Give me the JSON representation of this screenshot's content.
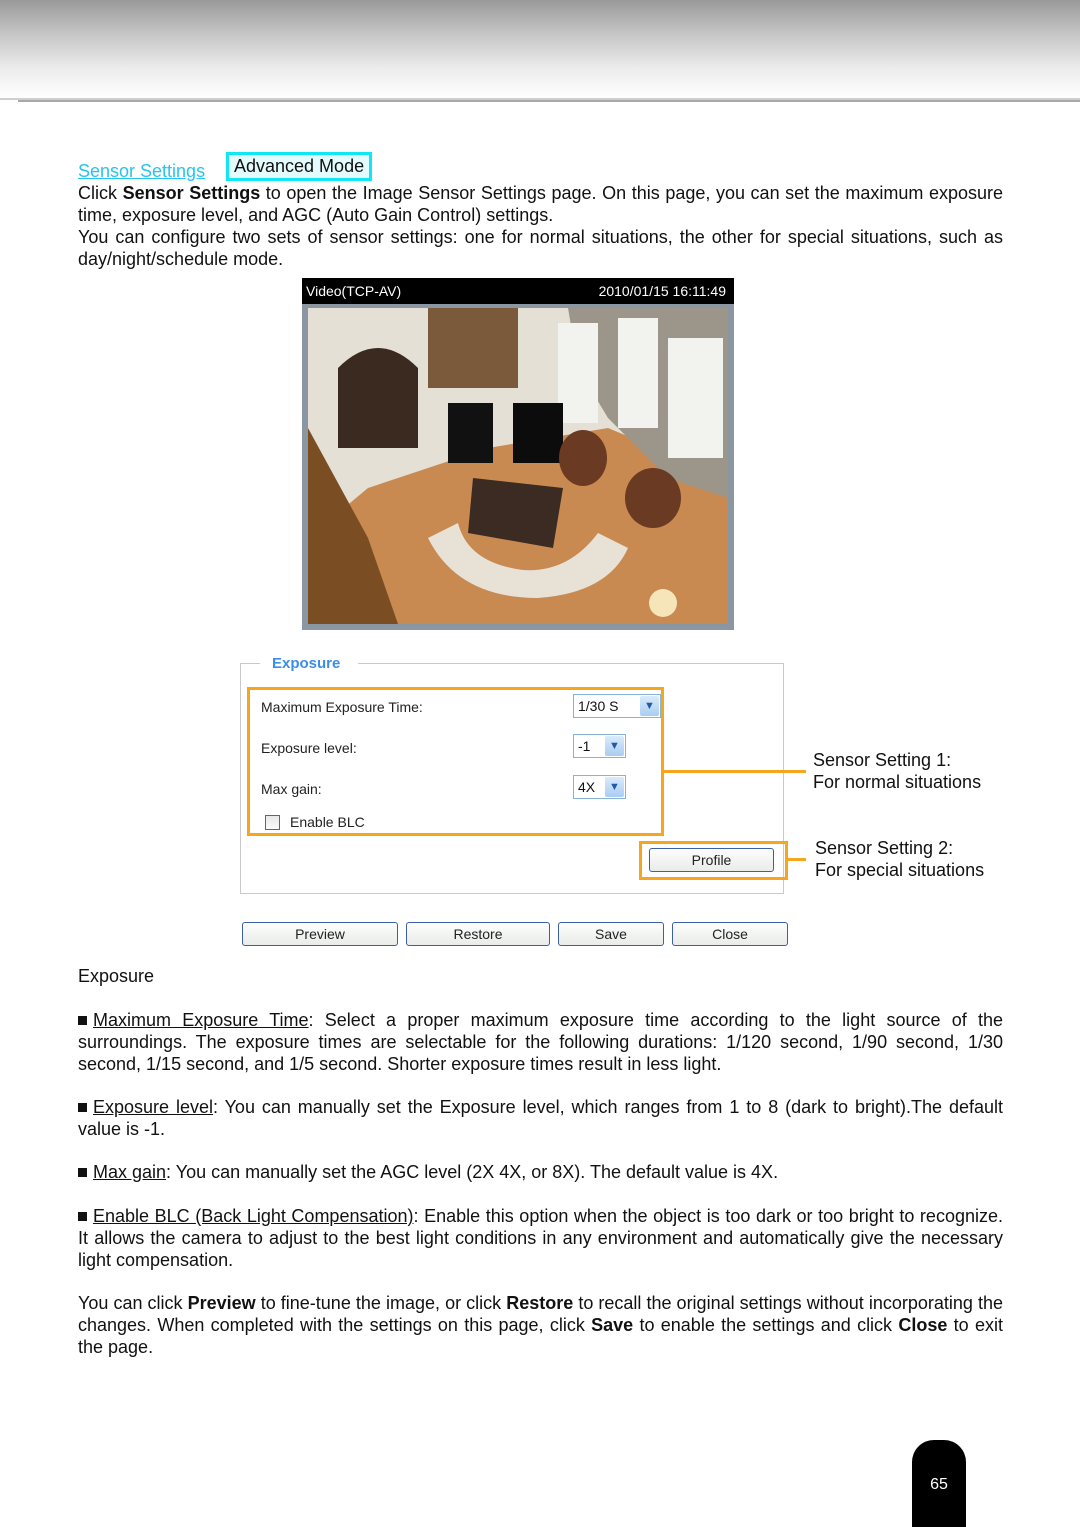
{
  "header": {
    "link": "Sensor Settings",
    "badge": "Advanced Mode"
  },
  "intro": {
    "p1_a": "Click ",
    "p1_bold": "Sensor Settings",
    "p1_b": " to open the Image Sensor Settings page. On this page, you can set the maximum exposure time, exposure level, and AGC (Auto Gain Control) settings.",
    "p2": "You can configure two sets of sensor settings: one for normal situations, the other for special situations, such as day/night/schedule mode."
  },
  "video": {
    "title": "Video(TCP-AV)",
    "timestamp": "2010/01/15 16:11:49"
  },
  "form": {
    "legend": "Exposure",
    "max_exposure_label": "Maximum Exposure Time:",
    "max_exposure_value": "1/30 S",
    "exposure_level_label": "Exposure level:",
    "exposure_level_value": "-1",
    "max_gain_label": "Max gain:",
    "max_gain_value": "4X",
    "blc_label": "Enable BLC",
    "blc_checked": false,
    "profile_button": "Profile",
    "buttons": {
      "preview": "Preview",
      "restore": "Restore",
      "save": "Save",
      "close": "Close"
    },
    "colors": {
      "legend": "#3d8ee6",
      "highlight": "#f7a51c"
    }
  },
  "callouts": {
    "s1_title": "Sensor Setting 1:",
    "s1_desc": "For normal situations",
    "s2_title": "Sensor Setting 2:",
    "s2_desc": "For special situations"
  },
  "section_title": "Exposure",
  "bullets": [
    {
      "term": "Maximum Exposure Time",
      "text": ": Select a proper maximum exposure time according to the light source of the surroundings. The exposure times are selectable for the following durations: 1/120 second, 1/90 second, 1/30 second, 1/15 second, and 1/5 second. Shorter exposure times result in less light."
    },
    {
      "term": "Exposure level",
      "text": ": You can manually set the Exposure level, which ranges from 1 to 8 (dark to bright).The default value is -1."
    },
    {
      "term": "Max gain",
      "text": ": You can manually set the AGC level (2X 4X, or 8X). The default value is 4X."
    },
    {
      "term": "Enable BLC (Back Light Compensation)",
      "text": ": Enable this option when the object is too dark or too bright to recognize. It allows the camera to adjust to the best light conditions in any environment and automatically give the necessary light compensation."
    }
  ],
  "closing": {
    "a": "You can click ",
    "b1": "Preview",
    "c": " to fine-tune the image, or click ",
    "b2": "Restore",
    "d": " to recall the original settings without incorporating the changes. When completed with the settings on this page, click ",
    "b3": "Save",
    "e": " to enable the settings and click ",
    "b4": "Close",
    "f": " to exit the page."
  },
  "page_number": "65"
}
